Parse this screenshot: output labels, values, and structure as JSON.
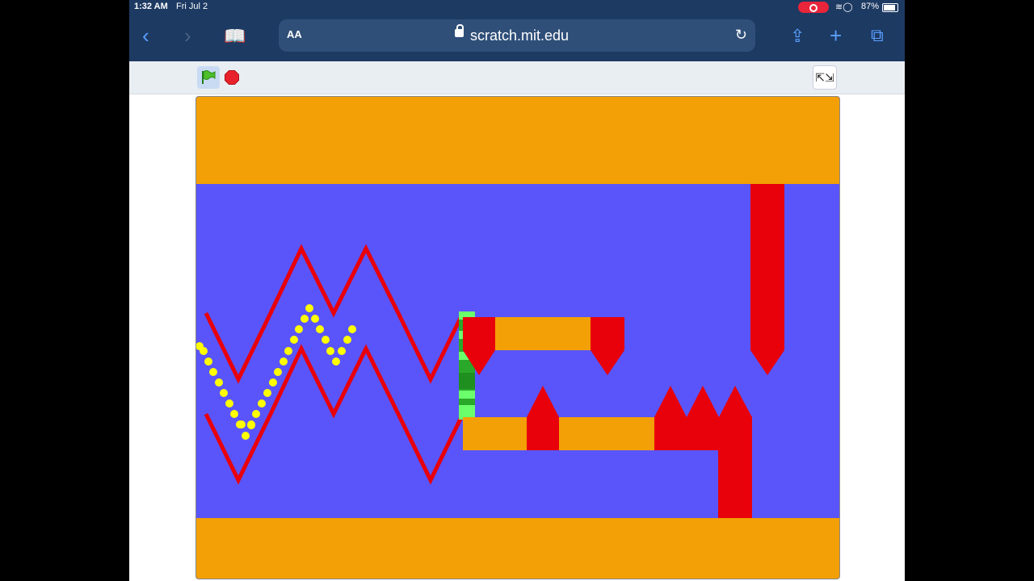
{
  "status_bar": {
    "time": "1:32 AM",
    "date": "Fri Jul 2",
    "battery": "87%",
    "icons": [
      "wifi-icon",
      "location-icon",
      "battery-icon",
      "screen-record-icon"
    ]
  },
  "browser": {
    "text_size_label": "AA",
    "url": "scratch.mit.edu",
    "icons": [
      "back-icon",
      "forward-icon",
      "bookmarks-icon",
      "lock-icon",
      "reload-icon",
      "share-icon",
      "new-tab-icon",
      "tabs-icon"
    ]
  },
  "player_controls": {
    "icons": [
      "green-flag-icon",
      "stop-icon",
      "exit-fullscreen-icon"
    ]
  },
  "game": {
    "colors": {
      "background": "#5a55fa",
      "wall": "#f2a005",
      "hazard": "#e8000b",
      "wave_trail": "#ffff00",
      "portal": "#44e444"
    }
  }
}
